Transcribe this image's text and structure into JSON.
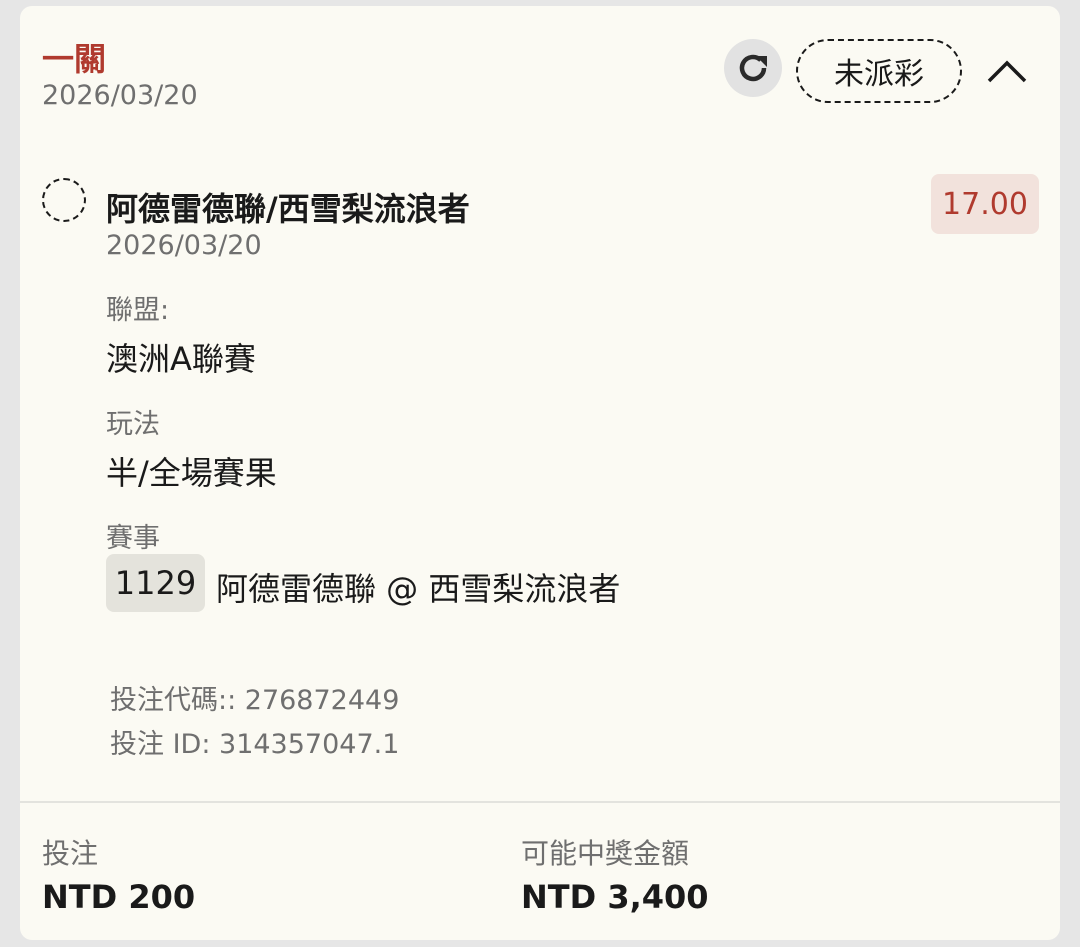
{
  "header": {
    "bet_type": "一關",
    "date": "2026/03/20",
    "status": "未派彩",
    "refresh_icon": "refresh-icon",
    "collapse_icon": "chevron-up-icon"
  },
  "selection": {
    "match": "阿德雷德聯/西雪梨流浪者",
    "date": "2026/03/20",
    "odds": "17.00",
    "league_label": "聯盟:",
    "league": "澳洲A聯賽",
    "market_label": "玩法",
    "market": "半/全場賽果",
    "event_label": "賽事",
    "event_number": "1129",
    "event_teams": "阿德雷德聯 @ 西雪梨流浪者"
  },
  "refs": {
    "bet_code": "投注代碼:: 276872449",
    "bet_id": "投注 ID: 314357047.1"
  },
  "summary": {
    "stake_label": "投注",
    "stake_value": "NTD 200",
    "payout_label": "可能中獎金額",
    "payout_value": "NTD 3,400"
  },
  "colors": {
    "accent": "#b03a2e",
    "card_bg": "#fbfaf3",
    "page_bg": "#e6e6e6"
  }
}
